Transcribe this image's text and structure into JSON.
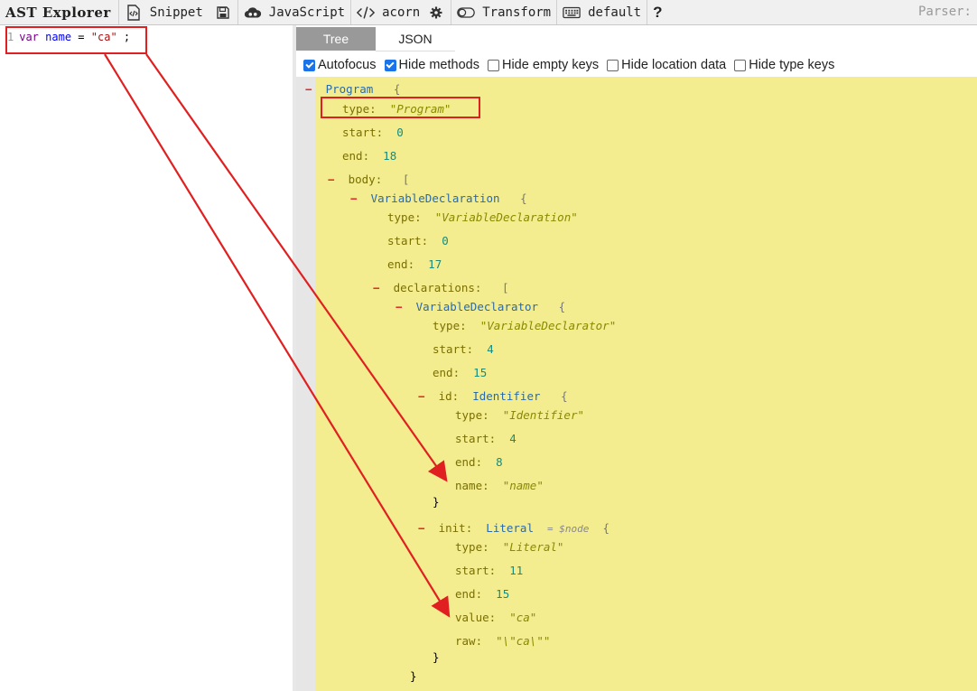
{
  "toolbar": {
    "brand": "AST Explorer",
    "snippet_label": "Snippet",
    "language_label": "JavaScript",
    "parser_label": "acorn",
    "transform_label": "Transform",
    "keymap_label": "default",
    "help_label": "?",
    "parser_side_label": "Parser:",
    "icons": [
      "file-code-icon",
      "save-icon",
      "cloud-icon",
      "code-brackets-icon",
      "gear-icon",
      "toggle-icon",
      "keyboard-icon",
      "help-icon"
    ]
  },
  "editor": {
    "line_number": "1",
    "code": {
      "keyword": "var",
      "name": "name",
      "equals": "=",
      "string": "\"ca\"",
      "semicolon": ";"
    }
  },
  "panel": {
    "tabs": [
      {
        "label": "Tree",
        "active": true
      },
      {
        "label": "JSON",
        "active": false
      }
    ],
    "options": [
      {
        "label": "Autofocus",
        "checked": true
      },
      {
        "label": "Hide methods",
        "checked": true
      },
      {
        "label": "Hide empty keys",
        "checked": false
      },
      {
        "label": "Hide location data",
        "checked": false
      },
      {
        "label": "Hide type keys",
        "checked": false
      }
    ]
  },
  "tree": {
    "program": {
      "label": "Program",
      "brace": "{"
    },
    "program_type": {
      "key": "type:",
      "value": "\"Program\""
    },
    "program_start": {
      "key": "start:",
      "value": "0"
    },
    "program_end": {
      "key": "end:",
      "value": "18"
    },
    "body": {
      "key": "body:",
      "bracket": "["
    },
    "var_decl": {
      "label": "VariableDeclaration",
      "brace": "{"
    },
    "var_decl_type": {
      "key": "type:",
      "value": "\"VariableDeclaration\""
    },
    "var_decl_start": {
      "key": "start:",
      "value": "0"
    },
    "var_decl_end": {
      "key": "end:",
      "value": "17"
    },
    "declarations": {
      "key": "declarations:",
      "bracket": "["
    },
    "declarator": {
      "label": "VariableDeclarator",
      "brace": "{"
    },
    "declarator_type": {
      "key": "type:",
      "value": "\"VariableDeclarator\""
    },
    "declarator_start": {
      "key": "start:",
      "value": "4"
    },
    "declarator_end": {
      "key": "end:",
      "value": "15"
    },
    "id": {
      "key": "id:",
      "type": "Identifier",
      "brace": "{"
    },
    "id_type": {
      "key": "type:",
      "value": "\"Identifier\""
    },
    "id_start": {
      "key": "start:",
      "value": "4"
    },
    "id_end": {
      "key": "end:",
      "value": "8"
    },
    "id_name": {
      "key": "name:",
      "value": "\"name\""
    },
    "id_close": "}",
    "init": {
      "key": "init:",
      "type": "Literal",
      "note": "= $node",
      "brace": "{"
    },
    "init_type": {
      "key": "type:",
      "value": "\"Literal\""
    },
    "init_start": {
      "key": "start:",
      "value": "11"
    },
    "init_end": {
      "key": "end:",
      "value": "15"
    },
    "init_value": {
      "key": "value:",
      "value": "\"ca\""
    },
    "init_raw": {
      "key": "raw:",
      "value": "\"\\\"ca\\\"\""
    },
    "init_close": "}",
    "declarator_close": "}",
    "toggle_glyph": "−"
  },
  "annotation_color": "#e02020",
  "tree_background": "#f3ed90"
}
